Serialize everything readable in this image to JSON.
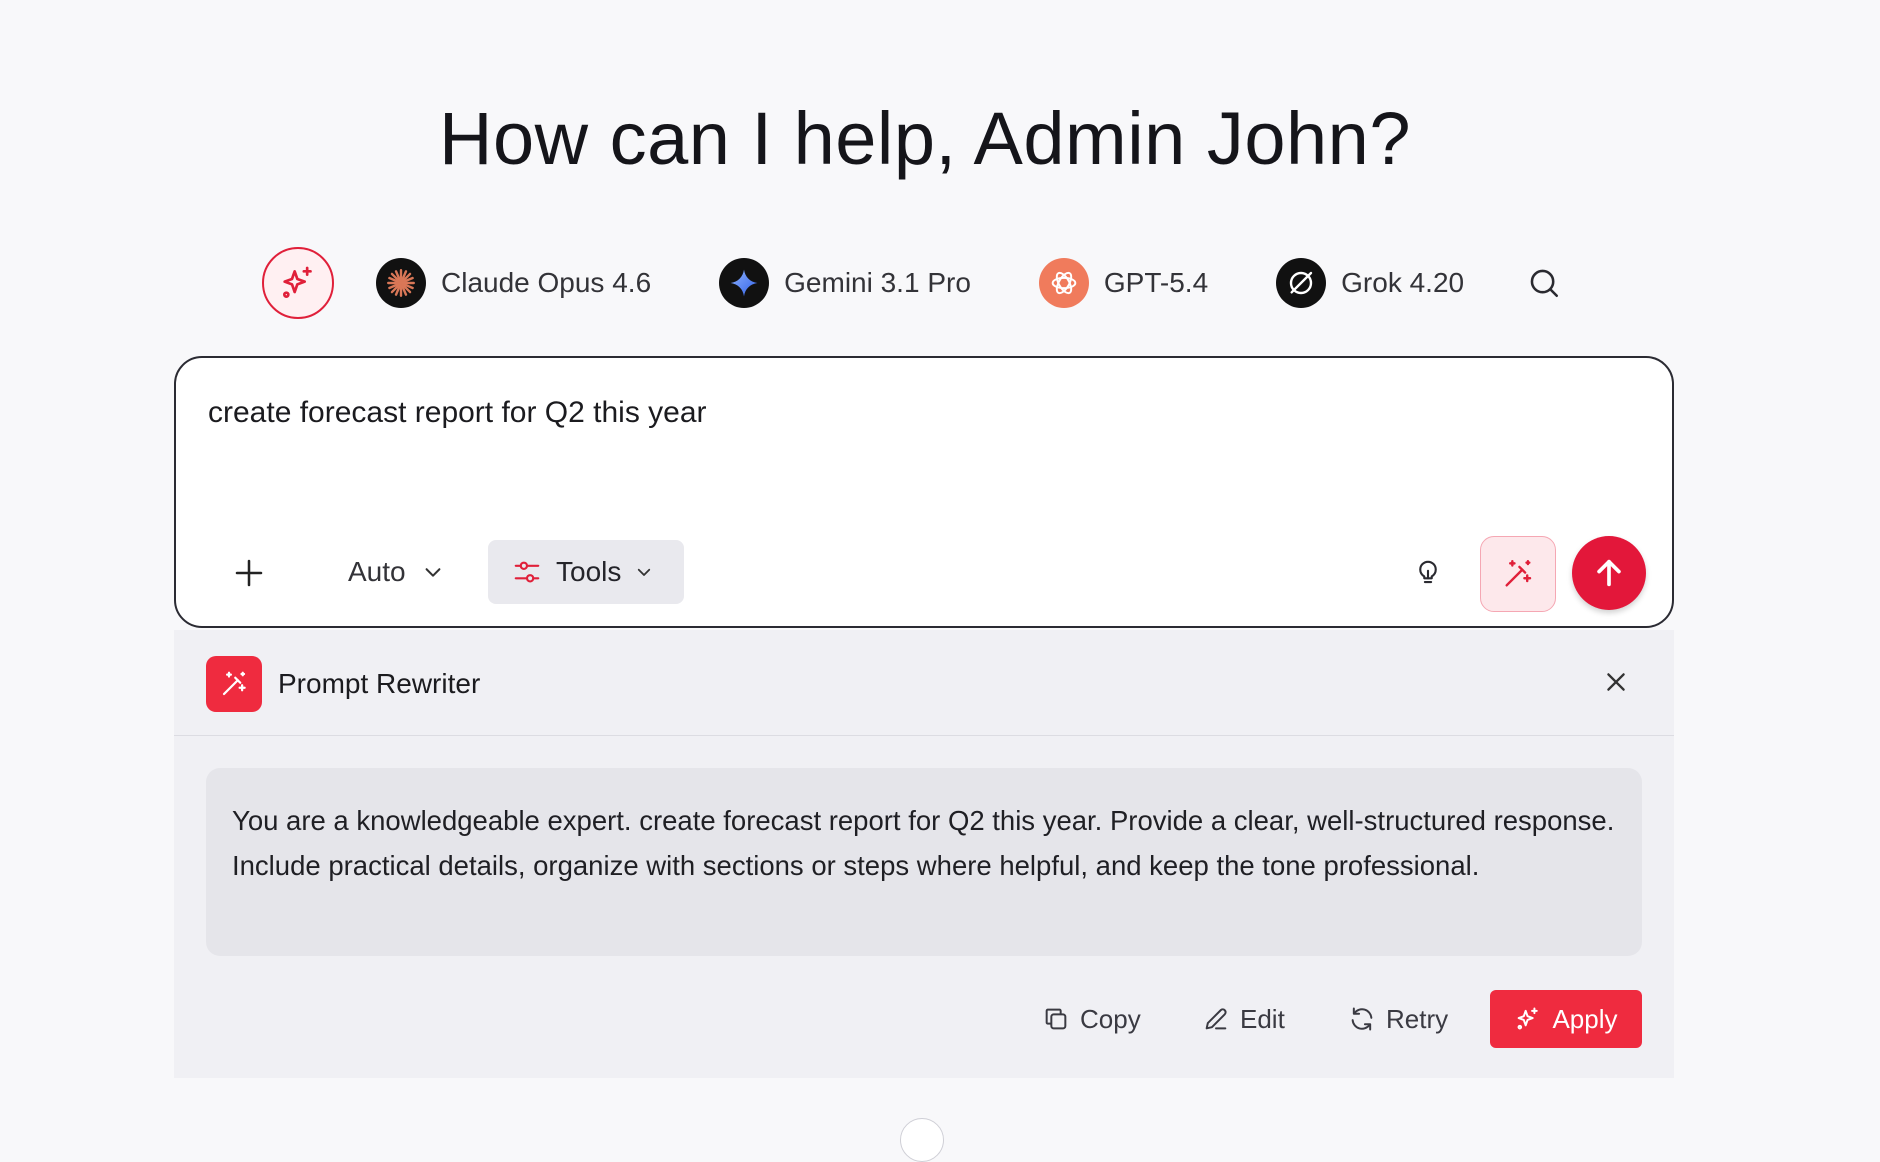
{
  "greeting": "How can I help, Admin John?",
  "models": [
    {
      "name": "Claude Opus 4.6",
      "icon": "claude-logo-icon",
      "color": "#d97757"
    },
    {
      "name": "Gemini 3.1 Pro",
      "icon": "gemini-logo-icon",
      "color": "#3b6ef5"
    },
    {
      "name": "GPT-5.4",
      "icon": "openai-logo-icon",
      "color": "#f07b5c"
    },
    {
      "name": "Grok 4.20",
      "icon": "grok-logo-icon",
      "color": "#111111"
    }
  ],
  "composer": {
    "value": "create forecast report for Q2 this year",
    "mode_label": "Auto",
    "tools_label": "Tools"
  },
  "rewriter": {
    "title": "Prompt Rewriter",
    "output": "You are a knowledgeable expert. create forecast report for Q2 this year. Provide a clear, well-structured response. Include practical details, organize with sections or steps where helpful, and keep the tone professional.",
    "actions": {
      "copy": "Copy",
      "edit": "Edit",
      "retry": "Retry",
      "apply": "Apply"
    }
  },
  "colors": {
    "accent": "#e3173a",
    "apply": "#ef2b3f"
  }
}
